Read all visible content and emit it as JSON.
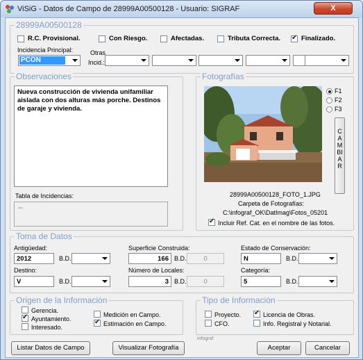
{
  "window": {
    "title": "ViSiG - Datos de Campo de 28999A00500128 - Usuario: SIGRAF",
    "close_label": "X"
  },
  "parcel": {
    "legend": "28999A00500128",
    "flags": [
      {
        "label": "R.C. Provisional.",
        "checked": false
      },
      {
        "label": "Con Riesgo.",
        "checked": false
      },
      {
        "label": "Afectadas.",
        "checked": false
      },
      {
        "label": "Tributa Correcta.",
        "checked": false
      },
      {
        "label": "Finalizado.",
        "checked": true
      }
    ],
    "incidencia_label": "Incidencia Principal:",
    "incidencia_value": "PCON",
    "otras_label_1": "Otras",
    "otras_label_2": "Incid.:"
  },
  "observaciones": {
    "legend": "Observaciones",
    "text": "Nueva construcción de vivienda unifamiliar aislada con dos alturas más porche. Destinos de garaje y vivienda.",
    "tabla_label": "Tabla de Incidencias:",
    "tabla_value": "--"
  },
  "fotografias": {
    "legend": "Fotografías",
    "options": [
      {
        "label": "F1",
        "selected": true
      },
      {
        "label": "F2",
        "selected": false
      },
      {
        "label": "F3",
        "selected": false
      }
    ],
    "cambiar_letters": [
      "C",
      "A",
      "M",
      "BI",
      "A",
      "R"
    ],
    "filename": "28999A00500128_FOTO_1.JPG",
    "carpeta_label": "Carpeta de Fotografías:",
    "carpeta_path": "C:\\infograf_OK\\DatImag\\Fotos_05201",
    "include_ref_label": "Incluir Ref. Cat. en el nombre de las fotos.",
    "include_ref_checked": true
  },
  "toma": {
    "legend": "Toma de Datos",
    "antiguedad_label": "Antigüedad:",
    "antiguedad_value": "2012",
    "superficie_label": "Superficie Construida:",
    "superficie_value": "166",
    "superficie_bd": "0",
    "estado_label": "Estado de Conservación:",
    "estado_value": "N",
    "destino_label": "Destino:",
    "destino_value": "V",
    "locales_label": "Número de Locales:",
    "locales_value": "3",
    "locales_bd": "0",
    "categoria_label": "Categoría:",
    "categoria_value": "5",
    "bd_label": "B.D."
  },
  "origen": {
    "legend": "Origen de la Información",
    "items": [
      {
        "label": "Gerencia.",
        "checked": false
      },
      {
        "label": "Ayuntamiento.",
        "checked": true
      },
      {
        "label": "Interesado.",
        "checked": false
      },
      {
        "label": "Medición en Campo.",
        "checked": false
      },
      {
        "label": "Estimación en Campo.",
        "checked": true
      }
    ]
  },
  "tipo": {
    "legend": "Tipo de Información",
    "items": [
      {
        "label": "Proyecto.",
        "checked": false
      },
      {
        "label": "CFO.",
        "checked": false
      },
      {
        "label": "Licencia de Obras.",
        "checked": true
      },
      {
        "label": "Info. Registral y Notarial.",
        "checked": false
      }
    ]
  },
  "footer": {
    "listar": "Listar Datos de Campo",
    "visualizar": "Visualizar Fotografía",
    "brand": "infograf",
    "aceptar": "Aceptar",
    "cancelar": "Cancelar"
  }
}
